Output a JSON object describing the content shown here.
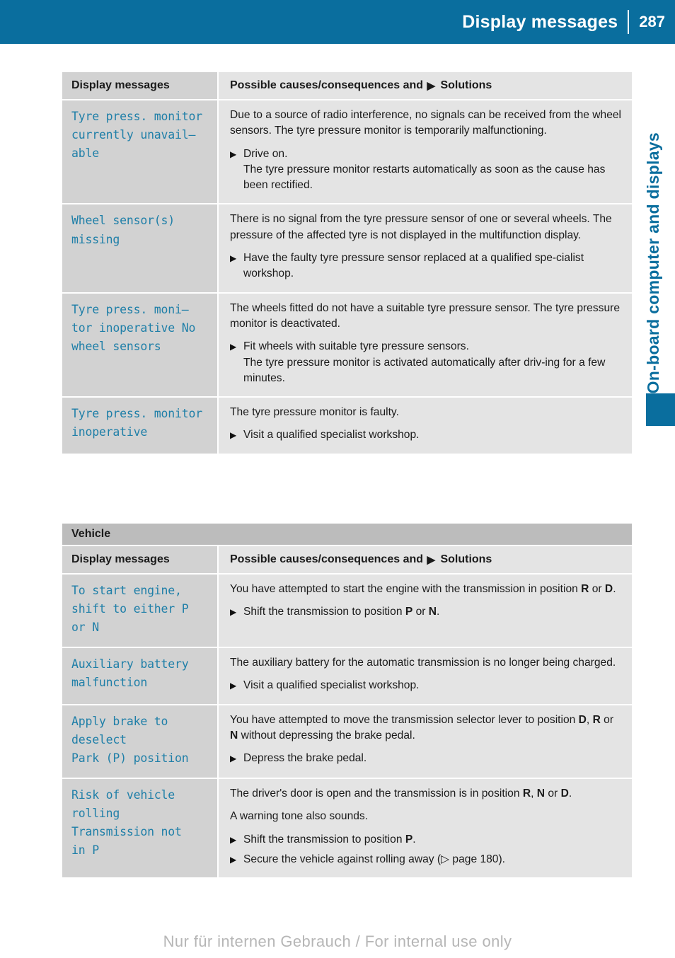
{
  "header": {
    "title": "Display messages",
    "page_number": "287",
    "band_color": "#0a6e9e"
  },
  "side": {
    "chapter_label": "On-board computer and displays",
    "tab_color": "#0a6e9e"
  },
  "tables": [
    {
      "section_title": null,
      "columns": {
        "left": "Display messages",
        "right_before": "Possible causes/consequences and",
        "right_after": "Solutions"
      },
      "rows": [
        {
          "message": "Tyre press. monitor\ncurrently unavail–\nable",
          "blocks": [
            {
              "type": "para",
              "html": "Due to a source of radio interference, no signals can be received from the wheel sensors. The tyre pressure monitor is temporarily malfunctioning."
            },
            {
              "type": "step",
              "html": "Drive on.",
              "continuation": "The tyre pressure monitor restarts automatically as soon as the cause has been rectified."
            }
          ]
        },
        {
          "message": "Wheel sensor(s)\nmissing",
          "blocks": [
            {
              "type": "para",
              "html": "There is no signal from the tyre pressure sensor of one or several wheels. The pressure of the affected tyre is not displayed in the multifunction display."
            },
            {
              "type": "step",
              "html": "Have the faulty tyre pressure sensor replaced at a qualified spe-cialist workshop.",
              "continuation": null
            }
          ]
        },
        {
          "message": "Tyre press. moni–\ntor inoperative No\nwheel sensors",
          "blocks": [
            {
              "type": "para",
              "html": "The wheels fitted do not have a suitable tyre pressure sensor. The tyre pressure monitor is deactivated."
            },
            {
              "type": "step",
              "html": "Fit wheels with suitable tyre pressure sensors.",
              "continuation": "The tyre pressure monitor is activated automatically after driv-ing for a few minutes."
            }
          ]
        },
        {
          "message": "Tyre press. monitor\ninoperative",
          "blocks": [
            {
              "type": "para",
              "html": "The tyre pressure monitor is faulty."
            },
            {
              "type": "step",
              "html": "Visit a qualified specialist workshop.",
              "continuation": null
            }
          ]
        }
      ]
    },
    {
      "section_title": "Vehicle",
      "columns": {
        "left": "Display messages",
        "right_before": "Possible causes/consequences and",
        "right_after": "Solutions"
      },
      "rows": [
        {
          "message": "To start engine,\nshift to either P\nor N",
          "blocks": [
            {
              "type": "para",
              "html": "You have attempted to start the engine with the transmission in position <b>R</b> or <b>D</b>."
            },
            {
              "type": "step",
              "html": "Shift the transmission to position <b>P</b> or <b>N</b>.",
              "continuation": null
            }
          ]
        },
        {
          "message": "Auxiliary battery\nmalfunction",
          "blocks": [
            {
              "type": "para",
              "html": "The auxiliary battery for the automatic transmission is no longer being charged."
            },
            {
              "type": "step",
              "html": "Visit a qualified specialist workshop.",
              "continuation": null
            }
          ]
        },
        {
          "message": "Apply brake to\ndeselect\nPark (P) position",
          "blocks": [
            {
              "type": "para",
              "html": "You have attempted to move the transmission selector lever to position <b>D</b>, <b>R</b> or <b>N</b> without depressing the brake pedal."
            },
            {
              "type": "step",
              "html": "Depress the brake pedal.",
              "continuation": null
            }
          ]
        },
        {
          "message": "Risk of vehicle\nrolling\nTransmission not\nin P",
          "blocks": [
            {
              "type": "para",
              "html": "The driver's door is open and the transmission is in position <b>R</b>, <b>N</b> or <b>D</b>."
            },
            {
              "type": "para",
              "html": "A warning tone also sounds."
            },
            {
              "type": "step",
              "html": "Shift the transmission to position <b>P</b>.",
              "continuation": null
            },
            {
              "type": "step",
              "html": "Secure the vehicle against rolling away (▷ page 180).",
              "continuation": null
            }
          ]
        }
      ]
    }
  ],
  "footer": {
    "watermark": "Nur für internen Gebrauch / For internal use only"
  }
}
